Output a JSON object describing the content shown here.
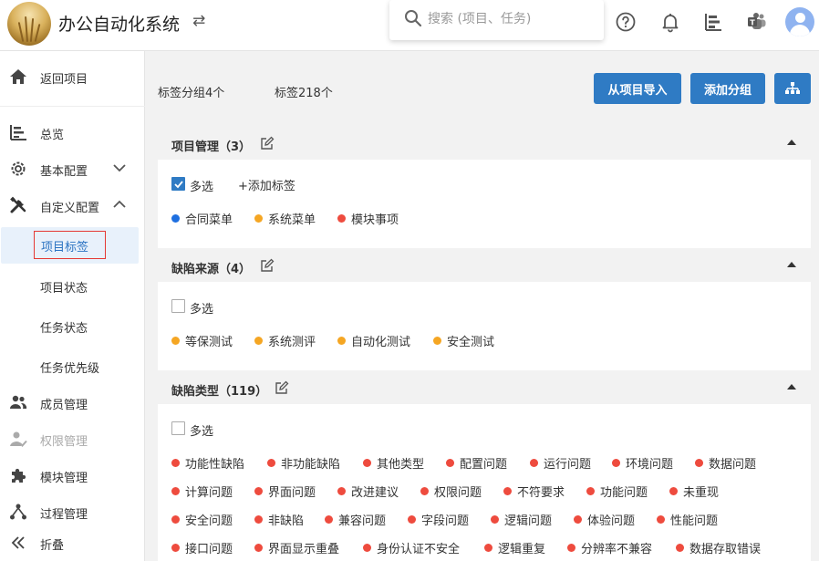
{
  "header": {
    "title": "办公自动化系统",
    "search_placeholder": "搜索 (项目、任务)"
  },
  "sidebar": {
    "items": [
      {
        "key": "back",
        "label": "返回项目",
        "icon": "home-icon"
      },
      {
        "key": "overview",
        "label": "总览",
        "icon": "overview-icon"
      },
      {
        "key": "basic",
        "label": "基本配置",
        "icon": "gear-icon",
        "expanded": false
      },
      {
        "key": "custom",
        "label": "自定义配置",
        "icon": "tools-icon",
        "expanded": true
      },
      {
        "key": "members",
        "label": "成员管理",
        "icon": "people-icon"
      },
      {
        "key": "permission",
        "label": "权限管理",
        "icon": "user-check-icon",
        "disabled": true
      },
      {
        "key": "modules",
        "label": "模块管理",
        "icon": "puzzle-icon"
      },
      {
        "key": "process",
        "label": "过程管理",
        "icon": "process-icon"
      },
      {
        "key": "collapse",
        "label": "折叠",
        "icon": "double-chevron-left-icon"
      }
    ],
    "subitems": [
      {
        "label": "项目标签",
        "active": true
      },
      {
        "label": "项目状态"
      },
      {
        "label": "任务状态"
      },
      {
        "label": "任务优先级"
      }
    ]
  },
  "summary": {
    "groups": "标签分组4个",
    "tags": "标签218个"
  },
  "buttons": {
    "import": "从项目导入",
    "add_group": "添加分组"
  },
  "colors": {
    "primary": "#2f7bc4",
    "dot_blue": "#1e6fe0",
    "dot_orange": "#f5a623",
    "dot_red": "#ee4b3e"
  },
  "groups": [
    {
      "title": "项目管理（3）",
      "multi_label": "多选",
      "multi_checked": true,
      "add_tag": "+添加标签",
      "tags": [
        {
          "label": "合同菜单",
          "color": "#1e6fe0"
        },
        {
          "label": "系统菜单",
          "color": "#f5a623"
        },
        {
          "label": "模块事项",
          "color": "#ee4b3e"
        }
      ]
    },
    {
      "title": "缺陷来源（4）",
      "multi_label": "多选",
      "multi_checked": false,
      "tags": [
        {
          "label": "等保测试",
          "color": "#f5a623"
        },
        {
          "label": "系统测评",
          "color": "#f5a623"
        },
        {
          "label": "自动化测试",
          "color": "#f5a623"
        },
        {
          "label": "安全测试",
          "color": "#f5a623"
        }
      ]
    },
    {
      "title": "缺陷类型（119）",
      "multi_label": "多选",
      "multi_checked": false,
      "tag_rows": [
        [
          "功能性缺陷",
          "非功能缺陷",
          "其他类型",
          "配置问题",
          "运行问题",
          "环境问题",
          "数据问题"
        ],
        [
          "计算问题",
          "界面问题",
          "改进建议",
          "权限问题",
          "不符要求",
          "功能问题",
          "未重现"
        ],
        [
          "安全问题",
          "非缺陷",
          "兼容问题",
          "字段问题",
          "逻辑问题",
          "体验问题",
          "性能问题"
        ],
        [
          "接口问题",
          "界面显示重叠",
          "身份认证不安全",
          "逻辑重复",
          "分辨率不兼容",
          "数据存取错误"
        ]
      ],
      "tag_color": "#ee4b3e"
    }
  ]
}
